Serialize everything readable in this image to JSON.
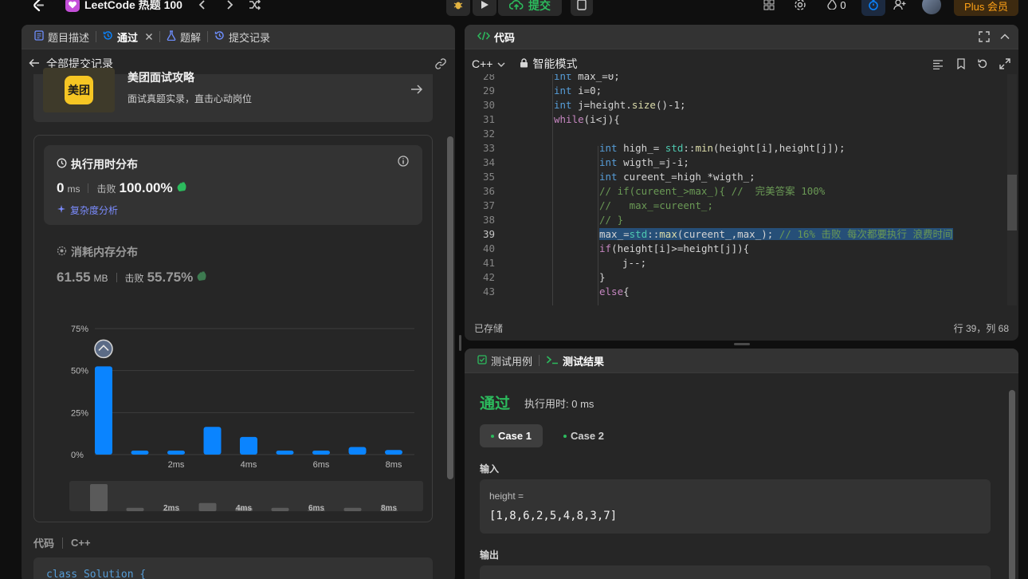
{
  "topbar": {
    "problem_list_title": "LeetCode 热题 100",
    "submit_label": "提交",
    "streak_count": "0",
    "plus_label": "Plus 会员"
  },
  "left_tabs": [
    {
      "label": "题目描述"
    },
    {
      "label": "通过"
    },
    {
      "label": "题解"
    },
    {
      "label": "提交记录"
    }
  ],
  "submissions": {
    "back_label": "全部提交记录",
    "banner": {
      "logo_text": "美团",
      "title": "美团面试攻略",
      "subtitle": "面试真题实录，直击心动岗位"
    },
    "runtime": {
      "title": "执行用时分布",
      "value": "0",
      "unit": "ms",
      "beat_label": "击败",
      "beat_value": "100.00%",
      "complexity_label": "复杂度分析"
    },
    "memory": {
      "title": "消耗内存分布",
      "value": "61.55",
      "unit": "MB",
      "beat_label": "击败",
      "beat_value": "55.75%"
    }
  },
  "chart_data": {
    "type": "bar",
    "categories": [
      "0ms",
      "1ms",
      "2ms",
      "3ms",
      "4ms",
      "5ms",
      "6ms",
      "7ms",
      "8ms"
    ],
    "x_tick_labels": [
      "",
      "",
      "2ms",
      "",
      "4ms",
      "",
      "6ms",
      "",
      "8ms"
    ],
    "values": [
      52.5,
      2.4,
      2.4,
      16.5,
      10.5,
      2.4,
      2.4,
      4.5,
      2.7
    ],
    "y_tick_labels": [
      "0%",
      "25%",
      "50%",
      "75%"
    ],
    "ylim": [
      0,
      75
    ],
    "highlight_index": 0,
    "bar_color": "#0a84ff",
    "overview_values": [
      80,
      10,
      4,
      24,
      10,
      10,
      4,
      10,
      4
    ],
    "overview_tick_labels": [
      "",
      "",
      "2ms",
      "",
      "4ms",
      "",
      "6ms",
      "",
      "8ms"
    ]
  },
  "code_footer": {
    "label": "代码",
    "lang": "C++",
    "preview": "class Solution {"
  },
  "code_panel": {
    "title": "代码",
    "language": "C++",
    "mode": "智能模式",
    "saved_label": "已存储",
    "cursor_label": "行 39，列 68",
    "lines": [
      {
        "num": "28",
        "indent": 1,
        "html": "<span class=\"kw\">int</span> max_=0;"
      },
      {
        "num": "29",
        "indent": 1,
        "html": "<span class=\"kw\">int</span> i=0;"
      },
      {
        "num": "30",
        "indent": 1,
        "html": "<span class=\"kw\">int</span> j=height.<span class=\"fn\">size</span>()-1;"
      },
      {
        "num": "31",
        "indent": 1,
        "html": "<span class=\"kw2\">while</span>(i&lt;j){"
      },
      {
        "num": "32",
        "indent": 1,
        "html": ""
      },
      {
        "num": "33",
        "indent": 2,
        "html": "<span class=\"kw\">int</span> high_= <span class=\"ns\">std</span>::<span class=\"fn\">min</span>(height[i],height[j]);"
      },
      {
        "num": "34",
        "indent": 2,
        "html": "<span class=\"kw\">int</span> wigth_=j-i;"
      },
      {
        "num": "35",
        "indent": 2,
        "html": "<span class=\"kw\">int</span> cureent_=high_*wigth_;"
      },
      {
        "num": "36",
        "indent": 2,
        "html": "<span class=\"cm\">// if(cureent_&gt;max_){ //  完美答案 100%</span>"
      },
      {
        "num": "37",
        "indent": 2,
        "html": "<span class=\"cm\">//   max_=cureent_;</span>"
      },
      {
        "num": "38",
        "indent": 2,
        "html": "<span class=\"cm\">// }</span>"
      },
      {
        "num": "39",
        "indent": 2,
        "html": "<span class=\"hl-sel\">max_=<span class=\"ns\">std</span>::<span class=\"fn\">max</span>(cureent_,max_); <span class=\"cm\">// 16% 击败 每次都要执行 浪费时间</span></span>"
      },
      {
        "num": "40",
        "indent": 2,
        "html": "<span class=\"kw2\">if</span>(height[i]&gt;=height[j]){"
      },
      {
        "num": "41",
        "indent": 3,
        "html": "j--;"
      },
      {
        "num": "42",
        "indent": 2,
        "html": "}"
      },
      {
        "num": "43",
        "indent": 2,
        "html": "<span class=\"kw2\">else</span>{"
      }
    ]
  },
  "result_panel": {
    "tab_testcase": "测试用例",
    "tab_result": "测试结果",
    "status": "通过",
    "time_label": "执行用时: 0 ms",
    "cases": [
      "Case 1",
      "Case 2"
    ],
    "input_label": "输入",
    "param_name": "height =",
    "param_value": "[1,8,6,2,5,4,8,3,7]",
    "output_label": "输出"
  },
  "colors": {
    "accent_green": "#2cbb5d",
    "accent_blue": "#0a84ff",
    "plus_orange": "#ffa116"
  }
}
